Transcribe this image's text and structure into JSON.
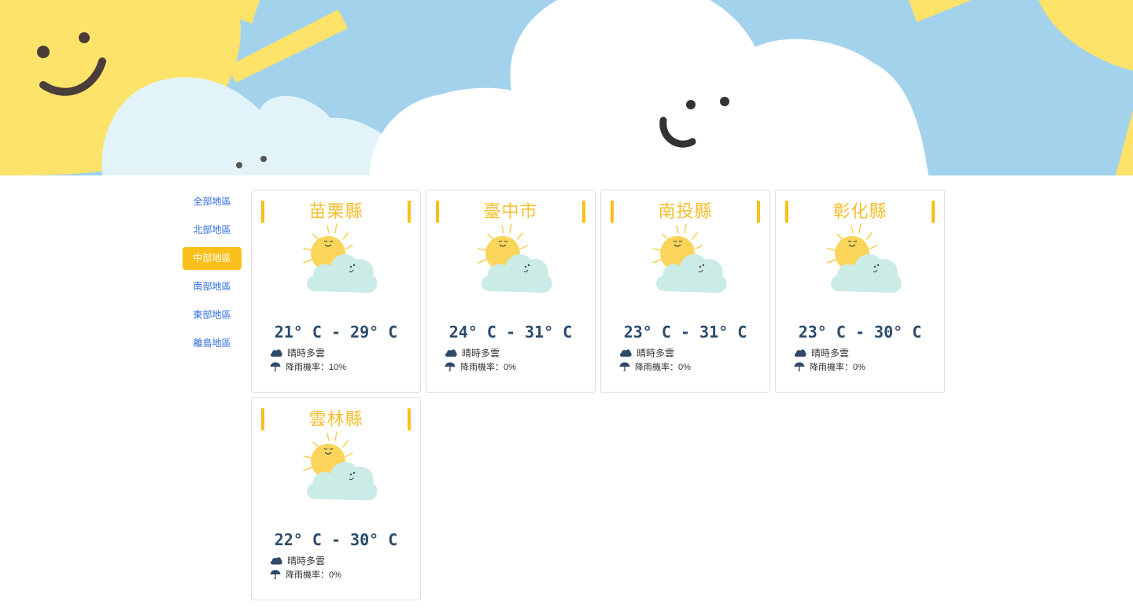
{
  "sidebar": {
    "items": [
      {
        "label": "全部地區",
        "active": false
      },
      {
        "label": "北部地區",
        "active": false
      },
      {
        "label": "中部地區",
        "active": true
      },
      {
        "label": "南部地區",
        "active": false
      },
      {
        "label": "東部地區",
        "active": false
      },
      {
        "label": "離島地區",
        "active": false
      }
    ]
  },
  "cards": [
    {
      "name": "苗栗縣",
      "temp": "21° C - 29° C",
      "description": "晴時多雲",
      "rain": "降雨機率：10%"
    },
    {
      "name": "臺中市",
      "temp": "24° C - 31° C",
      "description": "晴時多雲",
      "rain": "降雨機率：0%"
    },
    {
      "name": "南投縣",
      "temp": "23° C - 31° C",
      "description": "晴時多雲",
      "rain": "降雨機率：0%"
    },
    {
      "name": "彰化縣",
      "temp": "23° C - 30° C",
      "description": "晴時多雲",
      "rain": "降雨機率：0%"
    },
    {
      "name": "雲林縣",
      "temp": "22° C - 30° C",
      "description": "晴時多雲",
      "rain": "降雨機率：0%"
    }
  ],
  "icons": {
    "weather": "sun-behind-cloud-icon",
    "description": "cloud-icon",
    "rain": "umbrella-icon"
  },
  "colors": {
    "accent": "#fbbf1b",
    "title": "#f6be2c",
    "link": "#2e6be0",
    "temperature": "#2a4a6b",
    "sky": "#a3d2ec",
    "sun": "#fde36a"
  }
}
